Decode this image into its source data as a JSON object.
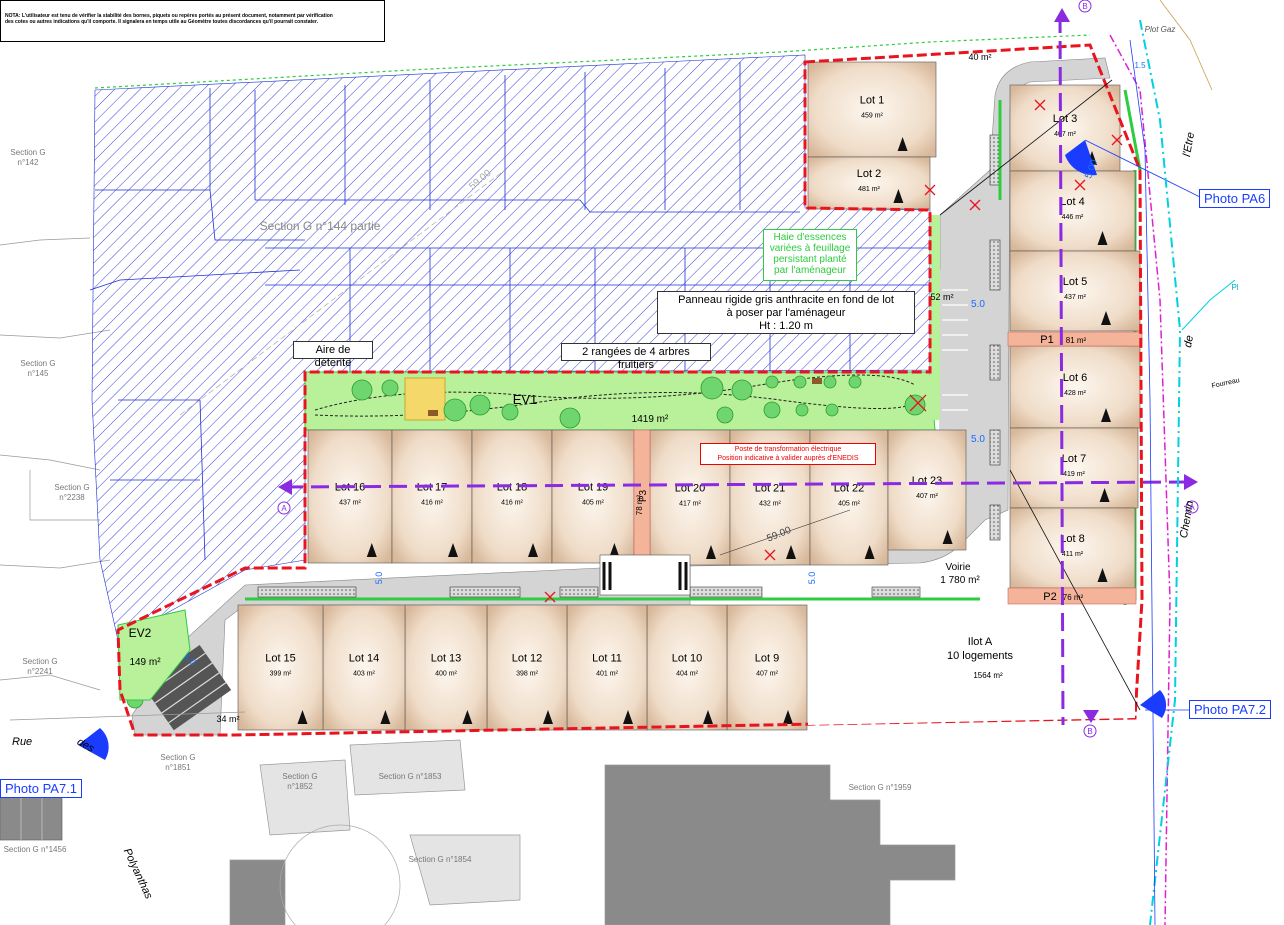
{
  "note": {
    "line1": "NOTA: L'utilisateur est tenu de vérifier la stabilité des bornes, piquets ou repères portés au présent document, notamment par vérification",
    "line2": "des cotes ou autres indications qu'il comporte. Il signalera en temps utile au Géomètre toutes discordances qu'il pourrait constater."
  },
  "sections": {
    "g142": "Section G\nn°142",
    "g144": "Section G n°144 partie",
    "g145": "Section G\nn°145",
    "g2238": "Section G\nn°2238",
    "g2241": "Section G\nn°2241",
    "g1851": "Section G\nn°1851",
    "g1852": "Section G\nn°1852",
    "g1853": "Section G n°1853",
    "g1854": "Section G n°1854",
    "g1959": "Section G n°1959",
    "g1456": "Section G n°1456"
  },
  "streets": {
    "plot_gaz": "Plot Gaz",
    "etre": "l'Etre",
    "de": "de",
    "chemin": "Chemin",
    "fourreau": "Fourreau",
    "rue": "Rue",
    "des": "des",
    "polyanthas": "Polyanthas",
    "pl": "Pl"
  },
  "lots": [
    {
      "name": "Lot 1",
      "area": "459 m²"
    },
    {
      "name": "Lot 2",
      "area": "481 m²"
    },
    {
      "name": "Lot 3",
      "area": "407 m²"
    },
    {
      "name": "Lot 4",
      "area": "446 m²"
    },
    {
      "name": "Lot 5",
      "area": "437 m²"
    },
    {
      "name": "Lot 6",
      "area": "428 m²"
    },
    {
      "name": "Lot 7",
      "area": "419 m²"
    },
    {
      "name": "Lot 8",
      "area": "411 m²"
    },
    {
      "name": "Lot 9",
      "area": "407 m²"
    },
    {
      "name": "Lot 10",
      "area": "404 m²"
    },
    {
      "name": "Lot 11",
      "area": "401 m²"
    },
    {
      "name": "Lot 12",
      "area": "398 m²"
    },
    {
      "name": "Lot 13",
      "area": "400 m²"
    },
    {
      "name": "Lot 14",
      "area": "403 m²"
    },
    {
      "name": "Lot 15",
      "area": "399 m²"
    },
    {
      "name": "Lot 16",
      "area": "437 m²"
    },
    {
      "name": "Lot 17",
      "area": "416 m²"
    },
    {
      "name": "Lot 18",
      "area": "416 m²"
    },
    {
      "name": "Lot 19",
      "area": "405 m²"
    },
    {
      "name": "Lot 20",
      "area": "417 m²"
    },
    {
      "name": "Lot 21",
      "area": "432 m²"
    },
    {
      "name": "Lot 22",
      "area": "405 m²"
    },
    {
      "name": "Lot 23",
      "area": "407 m²"
    }
  ],
  "zones": {
    "ev1": "EV1",
    "ev1_area": "1419 m²",
    "ev2": "EV2",
    "ev2_area": "149 m²",
    "voirie": "Voirie",
    "voirie_area": "1 780 m²",
    "ilot": "Ilot A",
    "ilot_sub": "10 logements",
    "ilot_area": "1564 m²",
    "p1": "P1",
    "p1_area": "81 m²",
    "p2": "P2",
    "p2_area": "76 m²",
    "p3": "P3",
    "p3_area": "78 m²",
    "a40": "40 m²",
    "a52": "52 m²",
    "a34": "34 m²"
  },
  "callouts": {
    "panneau": "Panneau rigide gris anthracite en fond de lot\nà poser par l'aménageur\nHt : 1.20 m",
    "aire": "Aire de détente",
    "rangees": "2 rangées de 4 arbres fruitiers",
    "haie": "Haie d'essences\nvariées à feuillage\npersistant planté\npar l'aménageur",
    "poste": "Poste de transformation électrique\nPosition indicative à valider auprès d'ENEDIS"
  },
  "photos": {
    "pa6": "Photo PA6",
    "pa71": "Photo PA7.1",
    "pa72": "Photo PA7.2"
  },
  "section_marks": {
    "a": "A",
    "b": "B"
  },
  "dims": {
    "d59a": "59.00",
    "d59b": "59.00",
    "d5a": "5.0",
    "d5b": "5.0",
    "d5c": "5.0",
    "d5d": "5.0",
    "d5e": "5.0",
    "d15": "1.5",
    "d100": "5.00"
  },
  "colors": {
    "boundary": "#e8141e",
    "green": "#2ecc40",
    "road": "#cfcfcf",
    "hatch": "#1f2fd6",
    "lot_center": "#fdf7ef",
    "lot_edge": "#d8b89a",
    "purple": "#8a2be2",
    "cyan": "#00d0e0",
    "magenta": "#e020d0"
  }
}
